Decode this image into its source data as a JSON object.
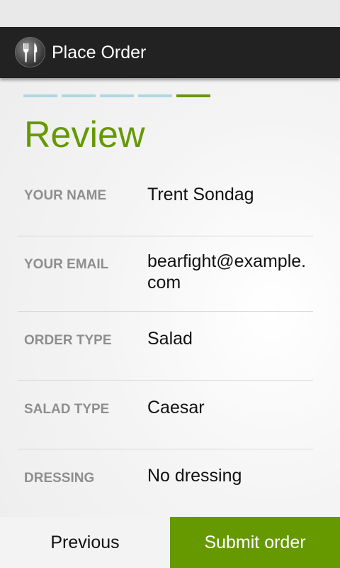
{
  "app": {
    "title": "Place Order",
    "icon": "fork-knife-icon"
  },
  "progress": {
    "total_steps": 5,
    "current_step": 5,
    "colors": {
      "inactive": "#add8e6",
      "active": "#669900"
    }
  },
  "page": {
    "heading": "Review"
  },
  "review_items": [
    {
      "label": "YOUR NAME",
      "value": "Trent Sondag"
    },
    {
      "label": "YOUR EMAIL",
      "value": "bearfight@example.com"
    },
    {
      "label": "ORDER TYPE",
      "value": "Salad"
    },
    {
      "label": "SALAD TYPE",
      "value": "Caesar"
    },
    {
      "label": "DRESSING",
      "value": "No dressing"
    }
  ],
  "buttons": {
    "previous": "Previous",
    "submit": "Submit order"
  },
  "colors": {
    "accent": "#669900",
    "action_bar": "#222222"
  }
}
